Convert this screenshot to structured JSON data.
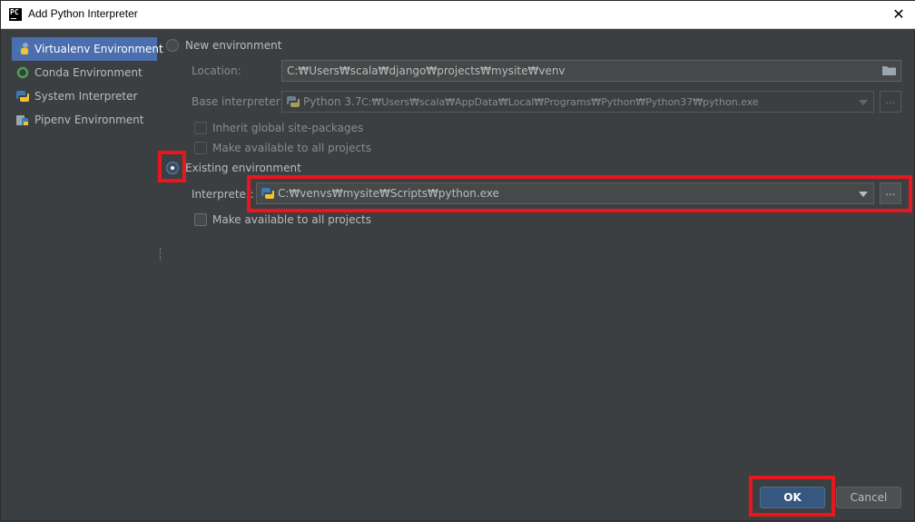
{
  "window": {
    "title": "Add Python Interpreter",
    "close_glyph": "✕"
  },
  "sidebar": {
    "items": [
      {
        "label": "Virtualenv Environment",
        "icon": "virtualenv-icon",
        "selected": true
      },
      {
        "label": "Conda Environment",
        "icon": "conda-icon",
        "selected": false
      },
      {
        "label": "System Interpreter",
        "icon": "python-icon",
        "selected": false
      },
      {
        "label": "Pipenv Environment",
        "icon": "pipenv-icon",
        "selected": false
      }
    ]
  },
  "new_env": {
    "label": "New environment",
    "selected": false,
    "location_label": "Location:",
    "location_value": "C:₩Users₩scala₩django₩projects₩mysite₩venv",
    "base_interpreter_label": "Base interpreter:",
    "base_interpreter_name": "Python 3.7",
    "base_interpreter_path": "C:₩Users₩scala₩AppData₩Local₩Programs₩Python₩Python37₩python.exe",
    "inherit_label": "Inherit global site-packages",
    "make_available_label": "Make available to all projects"
  },
  "existing_env": {
    "label": "Existing environment",
    "selected": true,
    "interpreter_label": "Interpreter:",
    "interpreter_value": "C:₩venvs₩mysite₩Scripts₩python.exe",
    "make_available_label": "Make available to all projects"
  },
  "browse_label": "...",
  "buttons": {
    "ok": "OK",
    "cancel": "Cancel"
  },
  "colors": {
    "background": "#3c3f41",
    "selection": "#4b6eaf",
    "highlight": "#e8161e",
    "ok_button": "#365880"
  }
}
